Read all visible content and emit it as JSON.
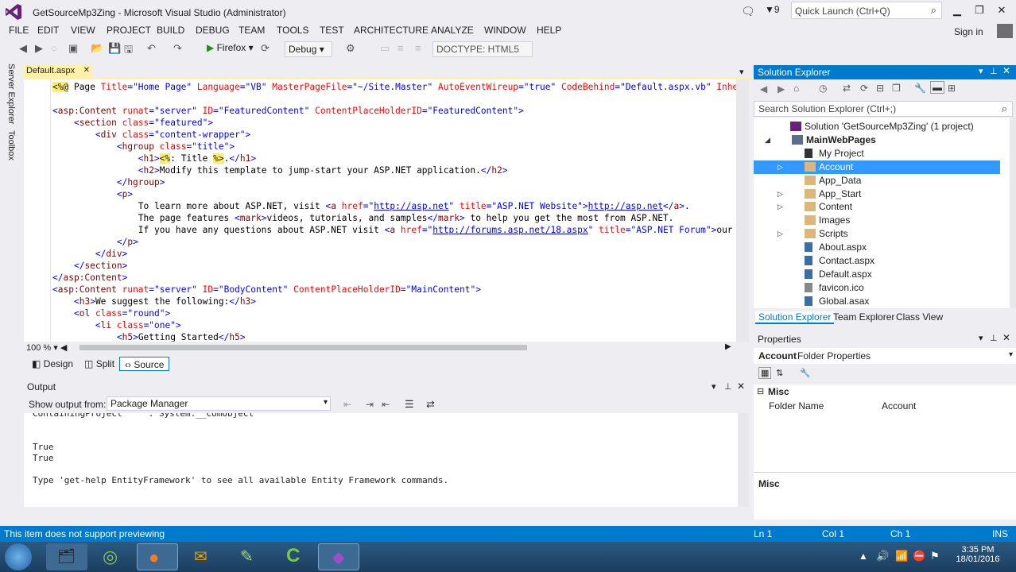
{
  "window": {
    "title": "GetSourceMp3Zing - Microsoft Visual Studio (Administrator)",
    "notification_count": "9",
    "quick_launch_placeholder": "Quick Launch (Ctrl+Q)",
    "sign_in": "Sign in"
  },
  "menu": [
    "FILE",
    "EDIT",
    "VIEW",
    "PROJECT",
    "BUILD",
    "DEBUG",
    "TEAM",
    "TOOLS",
    "TEST",
    "ARCHITECTURE",
    "ANALYZE",
    "WINDOW",
    "HELP"
  ],
  "toolbar": {
    "run_label": "Firefox",
    "config": "Debug",
    "doctype": "DOCTYPE: HTML5"
  },
  "left_rail": [
    "Server Explorer",
    "Toolbox"
  ],
  "document_tab": "Default.aspx",
  "editor": {
    "zoom": "100 %",
    "lines": [
      [
        [
          "hl",
          "<%@"
        ],
        [
          "tx",
          " Page "
        ],
        [
          "at",
          "Title"
        ],
        [
          "vl",
          "=\"Home Page\" "
        ],
        [
          "at",
          "Language"
        ],
        [
          "vl",
          "=\"VB\" "
        ],
        [
          "at",
          "MasterPageFile"
        ],
        [
          "vl",
          "=\"~/Site.Master\" "
        ],
        [
          "at",
          "AutoEventWireup"
        ],
        [
          "vl",
          "=\"true\" "
        ],
        [
          "at",
          "CodeBehind"
        ],
        [
          "vl",
          "=\"Default.aspx.vb\" "
        ],
        [
          "at",
          "Inherit"
        ]
      ],
      [],
      [
        [
          "br",
          "<"
        ],
        [
          "tag",
          "asp:Content"
        ],
        [
          "tx",
          " "
        ],
        [
          "at",
          "runat"
        ],
        [
          "vl",
          "=\"server\" "
        ],
        [
          "at",
          "ID"
        ],
        [
          "vl",
          "=\"FeaturedContent\" "
        ],
        [
          "at",
          "ContentPlaceHolderID"
        ],
        [
          "vl",
          "=\"FeaturedContent\""
        ],
        [
          "br",
          ">"
        ]
      ],
      [
        [
          "tx",
          "    "
        ],
        [
          "br",
          "<"
        ],
        [
          "tag",
          "section"
        ],
        [
          "tx",
          " "
        ],
        [
          "at",
          "class"
        ],
        [
          "vl",
          "=\"featured\""
        ],
        [
          "br",
          ">"
        ]
      ],
      [
        [
          "tx",
          "        "
        ],
        [
          "br",
          "<"
        ],
        [
          "tag",
          "div"
        ],
        [
          "tx",
          " "
        ],
        [
          "at",
          "class"
        ],
        [
          "vl",
          "=\"content-wrapper\""
        ],
        [
          "br",
          ">"
        ]
      ],
      [
        [
          "tx",
          "            "
        ],
        [
          "br",
          "<"
        ],
        [
          "tag",
          "hgroup"
        ],
        [
          "tx",
          " "
        ],
        [
          "at",
          "class"
        ],
        [
          "vl",
          "=\"title\""
        ],
        [
          "br",
          ">"
        ]
      ],
      [
        [
          "tx",
          "                "
        ],
        [
          "br",
          "<"
        ],
        [
          "tag",
          "h1"
        ],
        [
          "br",
          ">"
        ],
        [
          "hl",
          "<%"
        ],
        [
          "tx",
          ": Title "
        ],
        [
          "hl",
          "%>"
        ],
        [
          "tx",
          "."
        ],
        [
          "br",
          "</"
        ],
        [
          "tag",
          "h1"
        ],
        [
          "br",
          ">"
        ]
      ],
      [
        [
          "tx",
          "                "
        ],
        [
          "br",
          "<"
        ],
        [
          "tag",
          "h2"
        ],
        [
          "br",
          ">"
        ],
        [
          "tx",
          "Modify this template to jump-start your ASP.NET application."
        ],
        [
          "br",
          "</"
        ],
        [
          "tag",
          "h2"
        ],
        [
          "br",
          ">"
        ]
      ],
      [
        [
          "tx",
          "            "
        ],
        [
          "br",
          "</"
        ],
        [
          "tag",
          "hgroup"
        ],
        [
          "br",
          ">"
        ]
      ],
      [
        [
          "tx",
          "            "
        ],
        [
          "br",
          "<"
        ],
        [
          "tag",
          "p"
        ],
        [
          "br",
          ">"
        ]
      ],
      [
        [
          "tx",
          "                To learn more about ASP.NET, visit "
        ],
        [
          "br",
          "<"
        ],
        [
          "tag",
          "a"
        ],
        [
          "tx",
          " "
        ],
        [
          "at",
          "href"
        ],
        [
          "vl",
          "=\""
        ],
        [
          "ln",
          "http://asp.net"
        ],
        [
          "vl",
          "\" "
        ],
        [
          "at",
          "title"
        ],
        [
          "vl",
          "=\"ASP.NET Website\""
        ],
        [
          "br",
          ">"
        ],
        [
          "ln",
          "http://asp.net"
        ],
        [
          "br",
          "</"
        ],
        [
          "tag",
          "a"
        ],
        [
          "br",
          ">"
        ],
        [
          "tx",
          "."
        ]
      ],
      [
        [
          "tx",
          "                The page features "
        ],
        [
          "br",
          "<"
        ],
        [
          "tag",
          "mark"
        ],
        [
          "br",
          ">"
        ],
        [
          "tx",
          "videos, tutorials, and samples"
        ],
        [
          "br",
          "</"
        ],
        [
          "tag",
          "mark"
        ],
        [
          "br",
          ">"
        ],
        [
          "tx",
          " to help you get the most from ASP.NET."
        ]
      ],
      [
        [
          "tx",
          "                If you have any questions about ASP.NET visit "
        ],
        [
          "br",
          "<"
        ],
        [
          "tag",
          "a"
        ],
        [
          "tx",
          " "
        ],
        [
          "at",
          "href"
        ],
        [
          "vl",
          "=\""
        ],
        [
          "ln",
          "http://forums.asp.net/18.aspx"
        ],
        [
          "vl",
          "\" "
        ],
        [
          "at",
          "title"
        ],
        [
          "vl",
          "=\"ASP.NET Forum\""
        ],
        [
          "br",
          ">"
        ],
        [
          "tx",
          "our for"
        ]
      ],
      [
        [
          "tx",
          "            "
        ],
        [
          "br",
          "</"
        ],
        [
          "tag",
          "p"
        ],
        [
          "br",
          ">"
        ]
      ],
      [
        [
          "tx",
          "        "
        ],
        [
          "br",
          "</"
        ],
        [
          "tag",
          "div"
        ],
        [
          "br",
          ">"
        ]
      ],
      [
        [
          "tx",
          "    "
        ],
        [
          "br",
          "</"
        ],
        [
          "tag",
          "section"
        ],
        [
          "br",
          ">"
        ]
      ],
      [
        [
          "br",
          "</"
        ],
        [
          "tag",
          "asp:Content"
        ],
        [
          "br",
          ">"
        ]
      ],
      [
        [
          "br",
          "<"
        ],
        [
          "tag",
          "asp:Content"
        ],
        [
          "tx",
          " "
        ],
        [
          "at",
          "runat"
        ],
        [
          "vl",
          "=\"server\" "
        ],
        [
          "at",
          "ID"
        ],
        [
          "vl",
          "=\"BodyContent\" "
        ],
        [
          "at",
          "ContentPlaceHolderID"
        ],
        [
          "vl",
          "=\"MainContent\""
        ],
        [
          "br",
          ">"
        ]
      ],
      [
        [
          "tx",
          "    "
        ],
        [
          "br",
          "<"
        ],
        [
          "tag",
          "h3"
        ],
        [
          "br",
          ">"
        ],
        [
          "tx",
          "We suggest the following:"
        ],
        [
          "br",
          "</"
        ],
        [
          "tag",
          "h3"
        ],
        [
          "br",
          ">"
        ]
      ],
      [
        [
          "tx",
          "    "
        ],
        [
          "br",
          "<"
        ],
        [
          "tag",
          "ol"
        ],
        [
          "tx",
          " "
        ],
        [
          "at",
          "class"
        ],
        [
          "vl",
          "=\"round\""
        ],
        [
          "br",
          ">"
        ]
      ],
      [
        [
          "tx",
          "        "
        ],
        [
          "br",
          "<"
        ],
        [
          "tag",
          "li"
        ],
        [
          "tx",
          " "
        ],
        [
          "at",
          "class"
        ],
        [
          "vl",
          "=\"one\""
        ],
        [
          "br",
          ">"
        ]
      ],
      [
        [
          "tx",
          "            "
        ],
        [
          "br",
          "<"
        ],
        [
          "tag",
          "h5"
        ],
        [
          "br",
          ">"
        ],
        [
          "tx",
          "Getting Started"
        ],
        [
          "br",
          "</"
        ],
        [
          "tag",
          "h5"
        ],
        [
          "br",
          ">"
        ]
      ]
    ]
  },
  "view_tabs": [
    "Design",
    "Split",
    "Source"
  ],
  "output": {
    "title": "Output",
    "show_from_label": "Show output from:",
    "source": "Package Manager",
    "lines": [
      "ContainingProject     : System.__ComObject",
      "",
      "",
      "True",
      "True",
      "",
      "Type 'get-help EntityFramework' to see all available Entity Framework commands."
    ]
  },
  "solution_explorer": {
    "title": "Solution Explorer",
    "search_placeholder": "Search Solution Explorer (Ctrl+;)",
    "items": [
      {
        "label": "Solution 'GetSourceMp3Zing' (1 project)",
        "type": "solution"
      },
      {
        "label": "MainWebPages",
        "type": "project"
      },
      {
        "label": "My Project",
        "type": "wrench"
      },
      {
        "label": "Account",
        "type": "folder"
      },
      {
        "label": "App_Data",
        "type": "folder"
      },
      {
        "label": "App_Start",
        "type": "folder"
      },
      {
        "label": "Content",
        "type": "folder"
      },
      {
        "label": "Images",
        "type": "folder"
      },
      {
        "label": "Scripts",
        "type": "folder"
      },
      {
        "label": "About.aspx",
        "type": "file"
      },
      {
        "label": "Contact.aspx",
        "type": "file"
      },
      {
        "label": "Default.aspx",
        "type": "file"
      },
      {
        "label": "favicon.ico",
        "type": "ico"
      },
      {
        "label": "Global.asax",
        "type": "file"
      }
    ],
    "tabs": [
      "Solution Explorer",
      "Team Explorer",
      "Class View"
    ]
  },
  "properties": {
    "title": "Properties",
    "object": "Account",
    "object_type": "Folder Properties",
    "category": "Misc",
    "row_name": "Folder Name",
    "row_value": "Account",
    "description_title": "Misc"
  },
  "status": {
    "message": "This item does not support previewing",
    "ln": "Ln 1",
    "col": "Col 1",
    "ch": "Ch 1",
    "mode": "INS"
  },
  "taskbar": {
    "time": "3:35 PM",
    "date": "18/01/2016"
  },
  "colors": {
    "accent": "#007acc",
    "selection": "#3399ff",
    "tab_active": "#fff1a6"
  }
}
